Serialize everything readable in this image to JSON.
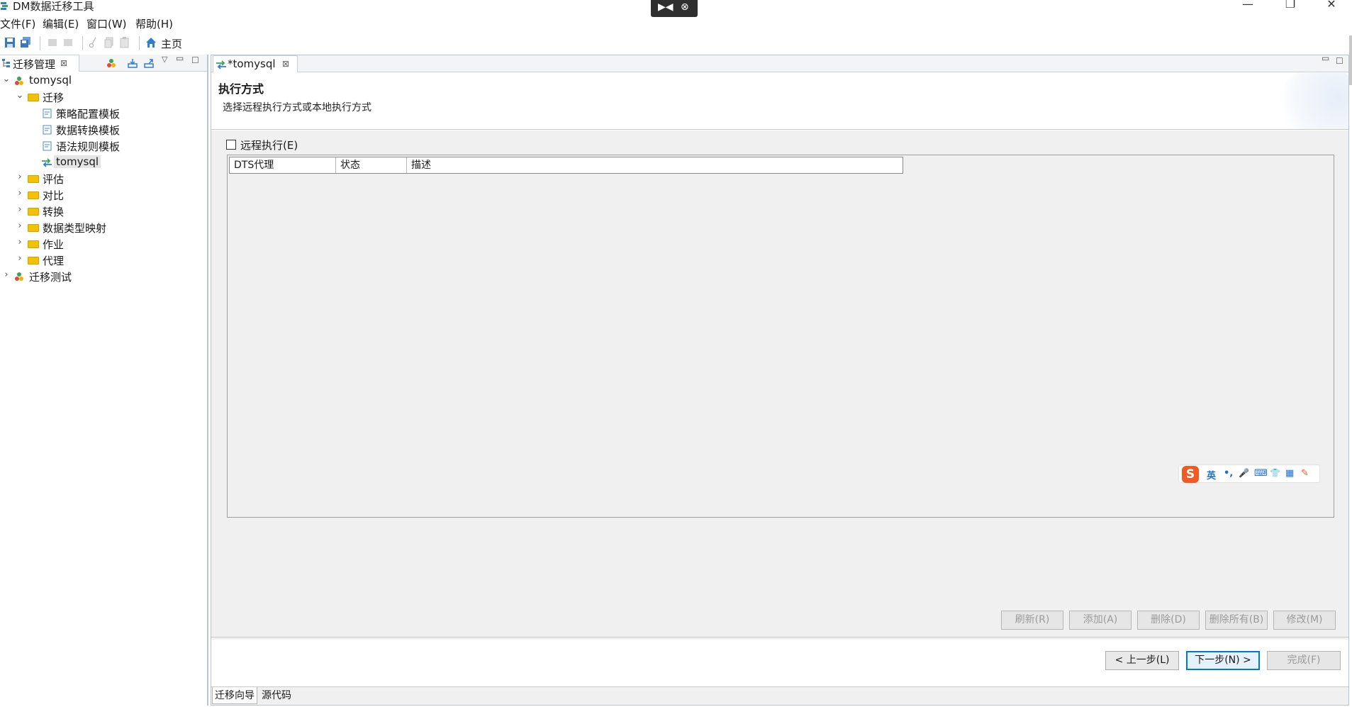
{
  "window": {
    "title": "DM数据迁移工具",
    "controls": {
      "minimize": "—",
      "restore": "❐",
      "close": "✕"
    }
  },
  "overlay": {
    "left_glyph": "▶◀",
    "right_glyph": "⊗"
  },
  "menu": {
    "items": [
      "文件(F)",
      "编辑(E)",
      "窗口(W)",
      "帮助(H)"
    ]
  },
  "toolbar": {
    "home_label": "主页"
  },
  "left_panel": {
    "tab_label": "迁移管理",
    "tree": [
      {
        "label": "tomysql",
        "level": 0,
        "expanded": true,
        "icon": "project-icon"
      },
      {
        "label": "迁移",
        "level": 1,
        "expanded": true,
        "icon": "folder-open-icon"
      },
      {
        "label": "策略配置模板",
        "level": 2,
        "icon": "template-icon"
      },
      {
        "label": "数据转换模板",
        "level": 2,
        "icon": "template-icon"
      },
      {
        "label": "语法规则模板",
        "level": 2,
        "icon": "template-icon"
      },
      {
        "label": "tomysql",
        "level": 2,
        "icon": "migration-icon",
        "selected": true
      },
      {
        "label": "评估",
        "level": 1,
        "expanded": false,
        "icon": "folder-icon"
      },
      {
        "label": "对比",
        "level": 1,
        "expanded": false,
        "icon": "folder-icon"
      },
      {
        "label": "转换",
        "level": 1,
        "expanded": false,
        "icon": "folder-icon"
      },
      {
        "label": "数据类型映射",
        "level": 1,
        "expanded": false,
        "icon": "folder-icon"
      },
      {
        "label": "作业",
        "level": 1,
        "expanded": false,
        "icon": "folder-icon"
      },
      {
        "label": "代理",
        "level": 1,
        "expanded": false,
        "icon": "folder-icon"
      },
      {
        "label": "迁移测试",
        "level": 0,
        "expanded": false,
        "icon": "project-icon"
      }
    ]
  },
  "editor": {
    "tab_label": "*tomysql",
    "header_title": "执行方式",
    "header_desc": "选择远程执行方式或本地执行方式",
    "remote_exec_label": "远程执行(E)",
    "remote_exec_checked": false,
    "table_columns": [
      "DTS代理",
      "状态",
      "描述"
    ],
    "action_buttons": [
      "刷新(R)",
      "添加(A)",
      "删除(D)",
      "删除所有(B)",
      "修改(M)"
    ],
    "nav_buttons": {
      "prev": "< 上一步(L)",
      "next": "下一步(N) >",
      "finish": "完成(F)"
    },
    "bottom_tabs": [
      "迁移向导",
      "源代码"
    ]
  },
  "ime": {
    "logo": "S",
    "items": [
      "英",
      "•,",
      "🎤",
      "⌨",
      "👕",
      "▦",
      "✎"
    ]
  },
  "colors": {
    "accent": "#0078d7",
    "folder": "#f2c200",
    "panel_border": "#b9c4d4",
    "body_bg": "#f0f0f0",
    "ime_brand": "#f15a24"
  }
}
